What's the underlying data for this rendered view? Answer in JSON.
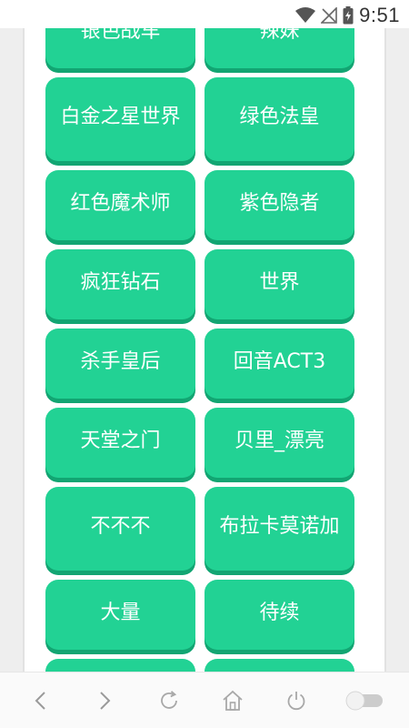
{
  "status_bar": {
    "time": "9:51",
    "icons": [
      "wifi-icon",
      "no-signal-icon",
      "battery-charging-icon"
    ]
  },
  "buttons": [
    {
      "label": "银色战车",
      "name": "silver-chariot"
    },
    {
      "label": "辣妹",
      "name": "spicy-girl"
    },
    {
      "label": "白金之星世界",
      "name": "star-platinum-the-world"
    },
    {
      "label": "绿色法皇",
      "name": "hierophant-green"
    },
    {
      "label": "红色魔术师",
      "name": "magicians-red"
    },
    {
      "label": "紫色隐者",
      "name": "hermit-purple"
    },
    {
      "label": "疯狂钻石",
      "name": "crazy-diamond"
    },
    {
      "label": "世界",
      "name": "the-world"
    },
    {
      "label": "杀手皇后",
      "name": "killer-queen"
    },
    {
      "label": "回音ACT3",
      "name": "echoes-act3"
    },
    {
      "label": "天堂之门",
      "name": "heavens-door"
    },
    {
      "label": "贝里_漂亮",
      "name": "beri-piaoliang"
    },
    {
      "label": "不不不",
      "name": "bububu"
    },
    {
      "label": "布拉卡莫诺加",
      "name": "bulakamonuojia"
    },
    {
      "label": "大量",
      "name": "daliang"
    },
    {
      "label": "待续",
      "name": "to-be-continued"
    },
    {
      "label": "",
      "name": "partial-left"
    },
    {
      "label": "",
      "name": "partial-right"
    }
  ],
  "nav_bar": {
    "items": [
      "back-icon",
      "forward-icon",
      "refresh-icon",
      "home-icon",
      "power-icon",
      "toggle-switch"
    ]
  },
  "colors": {
    "button": "#22d294",
    "button_shadow": "#12a572",
    "button_text": "#ffffff",
    "background": "#eeeeee"
  }
}
